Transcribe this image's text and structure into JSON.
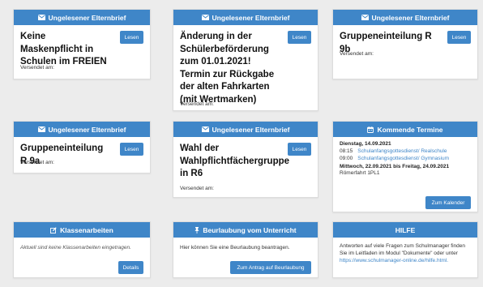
{
  "colors": {
    "header": "#3f86c8",
    "button": "#3f86c8",
    "background": "#ececec"
  },
  "letter_cards": [
    {
      "header": "Ungelesener Elternbrief",
      "title": "Keine Maskenpflicht in Schulen im FREIEN",
      "button": "Lesen",
      "sent_label": "Versendet am:"
    },
    {
      "header": "Ungelesener Elternbrief",
      "title": "Änderung in der Schülerbeförderung zum 01.01.2021! Termin zur Rückgabe der alten Fahrkarten (mit Wertmarken)",
      "button": "Lesen",
      "sent_label": "Versendet am:"
    },
    {
      "header": "Ungelesener Elternbrief",
      "title": "Gruppeneinteilung R 9b",
      "button": "Lesen",
      "sent_label": "Versendet am:"
    },
    {
      "header": "Ungelesener Elternbrief",
      "title": "Gruppeneinteilung R 9a",
      "button": "Lesen",
      "sent_label": "Versendet am:"
    },
    {
      "header": "Ungelesener Elternbrief",
      "title": "Wahl der Wahlpflichtfächergruppe in R6",
      "button": "Lesen",
      "sent_label": "Versendet am:"
    }
  ],
  "termine": {
    "header": "Kommende Termine",
    "day1": "Dienstag, 14.09.2021",
    "events": [
      {
        "time": "08:15",
        "label": "Schulanfangsgottesdienst/ Realschule"
      },
      {
        "time": "09:00",
        "label": "Schulanfangsgottesdienst/ Gymnasium"
      }
    ],
    "range": "Mittwoch, 22.09.2021 bis Freitag, 24.09.2021",
    "range_event": "Römerfahrt 1PL1",
    "button": "Zum Kalender"
  },
  "klassenarbeiten": {
    "header": "Klassenarbeiten",
    "text": "Aktuell sind keine Klassenarbeiten eingetragen.",
    "button": "Details"
  },
  "beurlaubung": {
    "header": "Beurlaubung vom Unterricht",
    "text": "Hier können Sie eine Beurlaubung beantragen.",
    "button": "Zum Antrag auf Beurlaubung"
  },
  "hilfe": {
    "header": "HILFE",
    "text": "Antworten auf viele Fragen zum Schulmanager finden Sie im Leitfaden im Modul \"Dokumente\" oder unter",
    "link": "https://www.schulmanager-online.de/hilfe.html."
  }
}
